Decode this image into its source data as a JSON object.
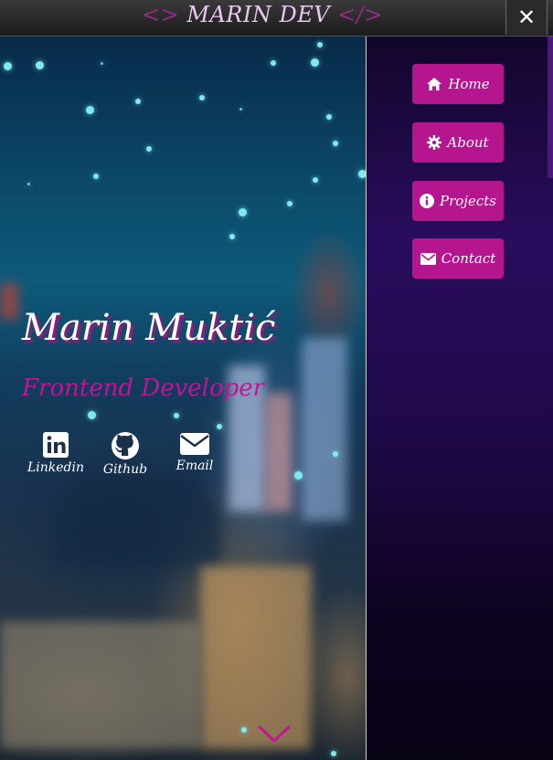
{
  "header": {
    "brand_open": "<>",
    "brand_name": " MARIN DEV ",
    "brand_close": "</>",
    "close_label": "✕"
  },
  "hero": {
    "name": "Marin Muktić",
    "role": "Frontend Developer",
    "socials": [
      {
        "label": "Linkedin",
        "icon": "linkedin-icon"
      },
      {
        "label": "Github",
        "icon": "github-icon"
      },
      {
        "label": "Email",
        "icon": "envelope-icon"
      }
    ],
    "scroll_icon": "chevron-down-icon"
  },
  "nav": {
    "items": [
      {
        "label": "Home",
        "icon": "home-icon"
      },
      {
        "label": "About",
        "icon": "gear-icon"
      },
      {
        "label": "Projects",
        "icon": "info-icon"
      },
      {
        "label": "Contact",
        "icon": "envelope-icon"
      }
    ]
  },
  "colors": {
    "accent": "#b5168f",
    "particle": "#7ee9ef",
    "panel": "#1e0948"
  }
}
